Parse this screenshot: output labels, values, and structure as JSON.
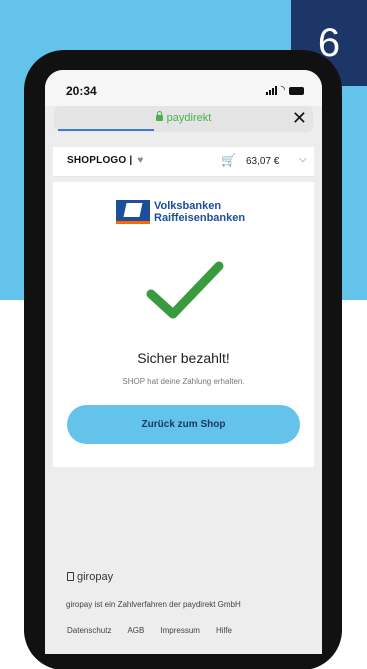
{
  "badge": {
    "step": "6"
  },
  "status": {
    "time": "20:34"
  },
  "browser": {
    "url": "paydirekt",
    "close": "✕"
  },
  "shop": {
    "logo": "SHOPLOGO |",
    "heart": "♥",
    "cart_icon": "🛒",
    "amount": "63,07 €",
    "chevron": "⌵"
  },
  "bank": {
    "line1": "Volksbanken",
    "line2": "Raiffeisenbanken"
  },
  "confirmation": {
    "title": "Sicher bezahlt!",
    "subtitle": "SHOP hat deine Zahlung erhalten.",
    "button": "Zurück zum Shop"
  },
  "footer": {
    "brand": "giropay",
    "note": "giropay ist ein Zahlverfahren der paydirekt GmbH",
    "links": [
      "Datenschutz",
      "AGB",
      "Impressum",
      "Hilfe"
    ]
  },
  "colors": {
    "accent": "#63c3ea",
    "navy": "#1b3667",
    "success": "#3a9a3e",
    "bank_blue": "#1b4e9b",
    "bank_orange": "#ff6600"
  }
}
